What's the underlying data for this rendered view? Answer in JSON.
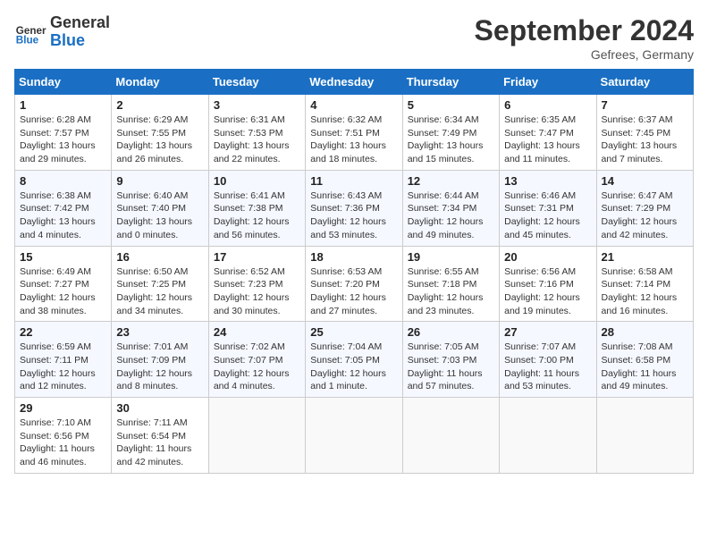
{
  "header": {
    "logo_general": "General",
    "logo_blue": "Blue",
    "month_year": "September 2024",
    "location": "Gefrees, Germany"
  },
  "columns": [
    "Sunday",
    "Monday",
    "Tuesday",
    "Wednesday",
    "Thursday",
    "Friday",
    "Saturday"
  ],
  "weeks": [
    [
      {
        "day": "1",
        "detail": "Sunrise: 6:28 AM\nSunset: 7:57 PM\nDaylight: 13 hours\nand 29 minutes."
      },
      {
        "day": "2",
        "detail": "Sunrise: 6:29 AM\nSunset: 7:55 PM\nDaylight: 13 hours\nand 26 minutes."
      },
      {
        "day": "3",
        "detail": "Sunrise: 6:31 AM\nSunset: 7:53 PM\nDaylight: 13 hours\nand 22 minutes."
      },
      {
        "day": "4",
        "detail": "Sunrise: 6:32 AM\nSunset: 7:51 PM\nDaylight: 13 hours\nand 18 minutes."
      },
      {
        "day": "5",
        "detail": "Sunrise: 6:34 AM\nSunset: 7:49 PM\nDaylight: 13 hours\nand 15 minutes."
      },
      {
        "day": "6",
        "detail": "Sunrise: 6:35 AM\nSunset: 7:47 PM\nDaylight: 13 hours\nand 11 minutes."
      },
      {
        "day": "7",
        "detail": "Sunrise: 6:37 AM\nSunset: 7:45 PM\nDaylight: 13 hours\nand 7 minutes."
      }
    ],
    [
      {
        "day": "8",
        "detail": "Sunrise: 6:38 AM\nSunset: 7:42 PM\nDaylight: 13 hours\nand 4 minutes."
      },
      {
        "day": "9",
        "detail": "Sunrise: 6:40 AM\nSunset: 7:40 PM\nDaylight: 13 hours\nand 0 minutes."
      },
      {
        "day": "10",
        "detail": "Sunrise: 6:41 AM\nSunset: 7:38 PM\nDaylight: 12 hours\nand 56 minutes."
      },
      {
        "day": "11",
        "detail": "Sunrise: 6:43 AM\nSunset: 7:36 PM\nDaylight: 12 hours\nand 53 minutes."
      },
      {
        "day": "12",
        "detail": "Sunrise: 6:44 AM\nSunset: 7:34 PM\nDaylight: 12 hours\nand 49 minutes."
      },
      {
        "day": "13",
        "detail": "Sunrise: 6:46 AM\nSunset: 7:31 PM\nDaylight: 12 hours\nand 45 minutes."
      },
      {
        "day": "14",
        "detail": "Sunrise: 6:47 AM\nSunset: 7:29 PM\nDaylight: 12 hours\nand 42 minutes."
      }
    ],
    [
      {
        "day": "15",
        "detail": "Sunrise: 6:49 AM\nSunset: 7:27 PM\nDaylight: 12 hours\nand 38 minutes."
      },
      {
        "day": "16",
        "detail": "Sunrise: 6:50 AM\nSunset: 7:25 PM\nDaylight: 12 hours\nand 34 minutes."
      },
      {
        "day": "17",
        "detail": "Sunrise: 6:52 AM\nSunset: 7:23 PM\nDaylight: 12 hours\nand 30 minutes."
      },
      {
        "day": "18",
        "detail": "Sunrise: 6:53 AM\nSunset: 7:20 PM\nDaylight: 12 hours\nand 27 minutes."
      },
      {
        "day": "19",
        "detail": "Sunrise: 6:55 AM\nSunset: 7:18 PM\nDaylight: 12 hours\nand 23 minutes."
      },
      {
        "day": "20",
        "detail": "Sunrise: 6:56 AM\nSunset: 7:16 PM\nDaylight: 12 hours\nand 19 minutes."
      },
      {
        "day": "21",
        "detail": "Sunrise: 6:58 AM\nSunset: 7:14 PM\nDaylight: 12 hours\nand 16 minutes."
      }
    ],
    [
      {
        "day": "22",
        "detail": "Sunrise: 6:59 AM\nSunset: 7:11 PM\nDaylight: 12 hours\nand 12 minutes."
      },
      {
        "day": "23",
        "detail": "Sunrise: 7:01 AM\nSunset: 7:09 PM\nDaylight: 12 hours\nand 8 minutes."
      },
      {
        "day": "24",
        "detail": "Sunrise: 7:02 AM\nSunset: 7:07 PM\nDaylight: 12 hours\nand 4 minutes."
      },
      {
        "day": "25",
        "detail": "Sunrise: 7:04 AM\nSunset: 7:05 PM\nDaylight: 12 hours\nand 1 minute."
      },
      {
        "day": "26",
        "detail": "Sunrise: 7:05 AM\nSunset: 7:03 PM\nDaylight: 11 hours\nand 57 minutes."
      },
      {
        "day": "27",
        "detail": "Sunrise: 7:07 AM\nSunset: 7:00 PM\nDaylight: 11 hours\nand 53 minutes."
      },
      {
        "day": "28",
        "detail": "Sunrise: 7:08 AM\nSunset: 6:58 PM\nDaylight: 11 hours\nand 49 minutes."
      }
    ],
    [
      {
        "day": "29",
        "detail": "Sunrise: 7:10 AM\nSunset: 6:56 PM\nDaylight: 11 hours\nand 46 minutes."
      },
      {
        "day": "30",
        "detail": "Sunrise: 7:11 AM\nSunset: 6:54 PM\nDaylight: 11 hours\nand 42 minutes."
      },
      {
        "day": "",
        "detail": ""
      },
      {
        "day": "",
        "detail": ""
      },
      {
        "day": "",
        "detail": ""
      },
      {
        "day": "",
        "detail": ""
      },
      {
        "day": "",
        "detail": ""
      }
    ]
  ]
}
